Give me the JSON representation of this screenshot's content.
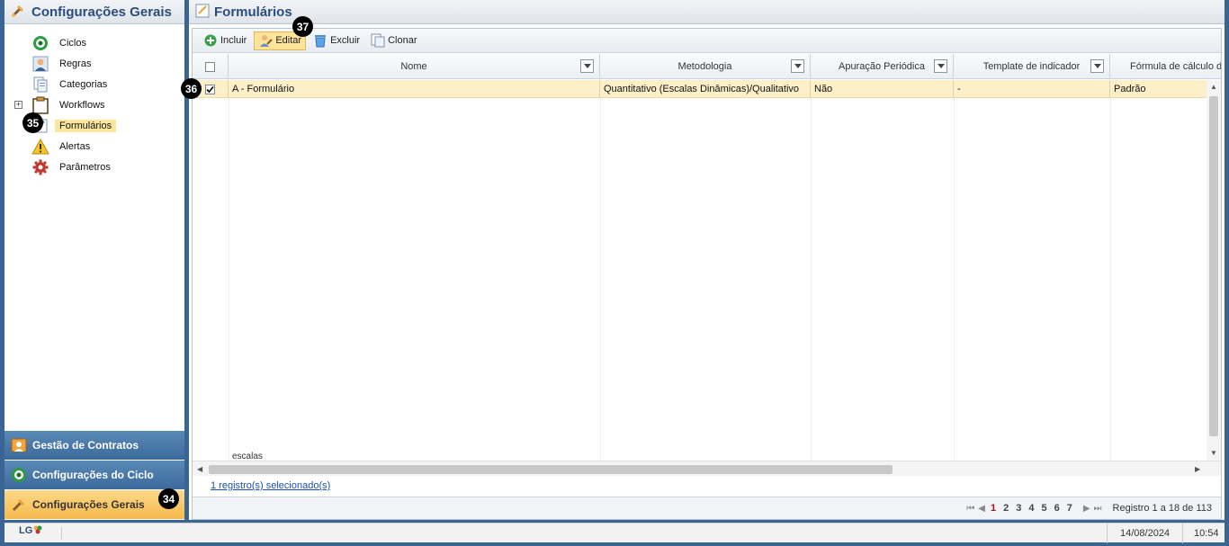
{
  "left_panel": {
    "title": "Configurações Gerais",
    "tree_items": [
      {
        "label": "Ciclos",
        "icon": "cycle-icon"
      },
      {
        "label": "Regras",
        "icon": "user-rules-icon"
      },
      {
        "label": "Categorias",
        "icon": "categories-icon"
      },
      {
        "label": "Workflows",
        "icon": "workflow-icon",
        "expandable": true
      },
      {
        "label": "Formulários",
        "icon": "forms-icon",
        "selected": true
      },
      {
        "label": "Alertas",
        "icon": "warning-icon"
      },
      {
        "label": "Parâmetros",
        "icon": "gear-icon"
      }
    ],
    "accordion": [
      {
        "label": "Gestão de Contratos",
        "icon": "contracts-icon"
      },
      {
        "label": "Configurações do Ciclo",
        "icon": "cycle-icon"
      },
      {
        "label": "Configurações Gerais",
        "icon": "tools-icon",
        "active": true
      }
    ]
  },
  "right_panel": {
    "title": "Formulários",
    "toolbar": {
      "include_label": "Incluir",
      "edit_label": "Editar",
      "delete_label": "Excluir",
      "clone_label": "Clonar"
    },
    "columns": [
      "Nome",
      "Metodologia",
      "Apuração Periódica",
      "Template de indicador",
      "Fórmula de cálculo d"
    ],
    "rows": [
      {
        "nome": "A - Formulário",
        "metodologia": "Quantitativo (Escalas Dinâmicas)/Qualitativo",
        "apuracao": "Não",
        "template": "-",
        "formula": "Padrão",
        "checked": true
      }
    ],
    "partial_text": "escalas",
    "selection_link": "1 registro(s) selecionado(s)",
    "pager": {
      "pages": [
        "1",
        "2",
        "3",
        "4",
        "5",
        "6",
        "7"
      ],
      "current": "1",
      "summary": "Registro 1 a 18 de 113"
    }
  },
  "badges": {
    "b34": "34",
    "b35": "35",
    "b36": "36",
    "b37": "37"
  },
  "status_bar": {
    "logo": "LG",
    "date": "14/08/2024",
    "time": "10:54"
  },
  "colors": {
    "header_text": "#2a4e7c",
    "selection": "#fdf0c8",
    "accent": "#f6b84a"
  }
}
